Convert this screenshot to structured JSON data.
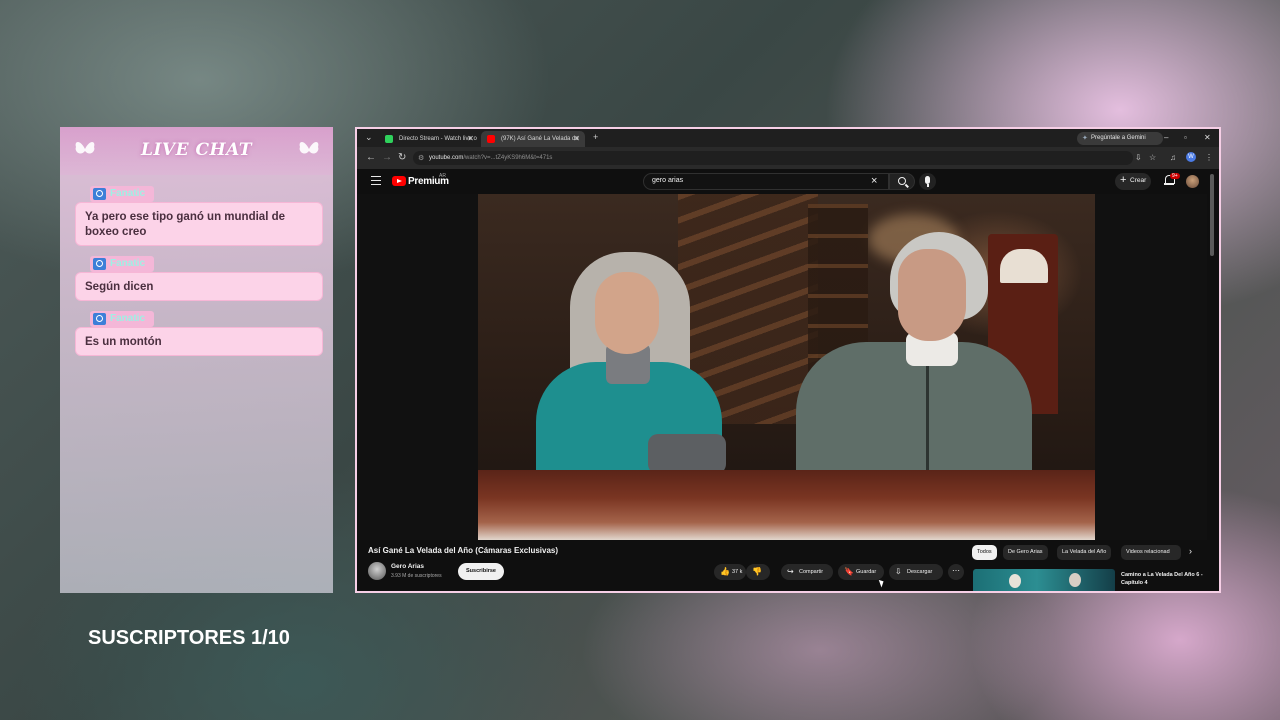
{
  "overlay": {
    "chat_title": "LIVE CHAT",
    "messages": [
      {
        "user": "Fanatic",
        "text": "Ya pero ese tipo ganó un mundial de boxeo creo"
      },
      {
        "user": "Fanatic",
        "text": "Según dicen"
      },
      {
        "user": "Fanatic",
        "text": "Es un montón"
      }
    ],
    "subs_counter": "SUSCRIPTORES 1/10",
    "accent_color": "#fcd3e8"
  },
  "browser": {
    "tabs": [
      {
        "label": "Directo Stream - Watch live o",
        "favicon": "stream-favicon"
      },
      {
        "label": "(97K) Así Gané La Velada de",
        "favicon": "youtube-favicon",
        "active": true
      }
    ],
    "gemini_label": "Pregúntale a Gemini",
    "url_host": "youtube.com",
    "url_path": "/watch?v=...tZ4yKS9h6M&t=471s",
    "profile_initial": "W"
  },
  "youtube": {
    "brand": "Premium",
    "region": "AR",
    "search_query": "gero arias",
    "create_label": "Crear",
    "notif_count": "9+",
    "video_title": "Así Gané La Velada del Año (Cámaras Exclusivas)",
    "channel_name": "Gero Arias",
    "channel_subs": "3.93 M de suscriptores",
    "subscribe_label": "Suscribirse",
    "likes": "37 k",
    "share_label": "Compartir",
    "save_label": "Guardar",
    "download_label": "Descargar",
    "chips": [
      "Todos",
      "De Gero Arias",
      "La Velada del Año",
      "Videos relacionad"
    ],
    "related_title": "Camino a La Velada Del Año 6 - Capítulo 4"
  }
}
